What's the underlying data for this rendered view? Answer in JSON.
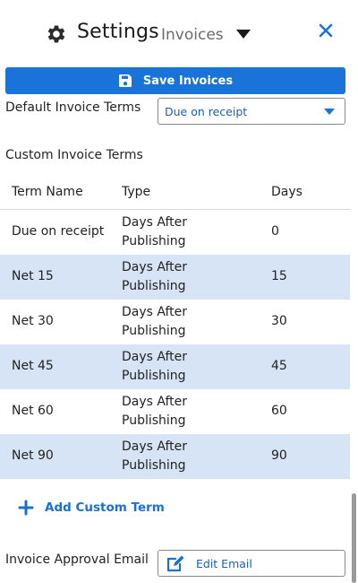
{
  "header": {
    "title": "Settings",
    "subtitle": "Invoices",
    "icon": "gear-icon",
    "close_icon": "close-icon"
  },
  "toolbar": {
    "save_label": "Save Invoices",
    "save_icon": "floppy-disk-icon",
    "accent": "#1a73d9"
  },
  "default_terms": {
    "label": "Default Invoice Terms",
    "selected": "Due on receipt"
  },
  "custom_terms": {
    "heading": "Custom Invoice Terms",
    "columns": [
      "Term Name",
      "Type",
      "Days"
    ],
    "rows": [
      {
        "name": "Due on receipt",
        "type": "Days After Publishing",
        "days": "0"
      },
      {
        "name": "Net 15",
        "type": "Days After Publishing",
        "days": "15"
      },
      {
        "name": "Net 30",
        "type": "Days After Publishing",
        "days": "30"
      },
      {
        "name": "Net 45",
        "type": "Days After Publishing",
        "days": "45"
      },
      {
        "name": "Net 60",
        "type": "Days After Publishing",
        "days": "60"
      },
      {
        "name": "Net 90",
        "type": "Days After Publishing",
        "days": "90"
      }
    ],
    "row_highlight": "#d6e4f5",
    "add_label": "Add Custom Term"
  },
  "approval": {
    "label": "Invoice Approval Email",
    "button_label": "Edit Email",
    "button_icon": "edit-icon"
  }
}
